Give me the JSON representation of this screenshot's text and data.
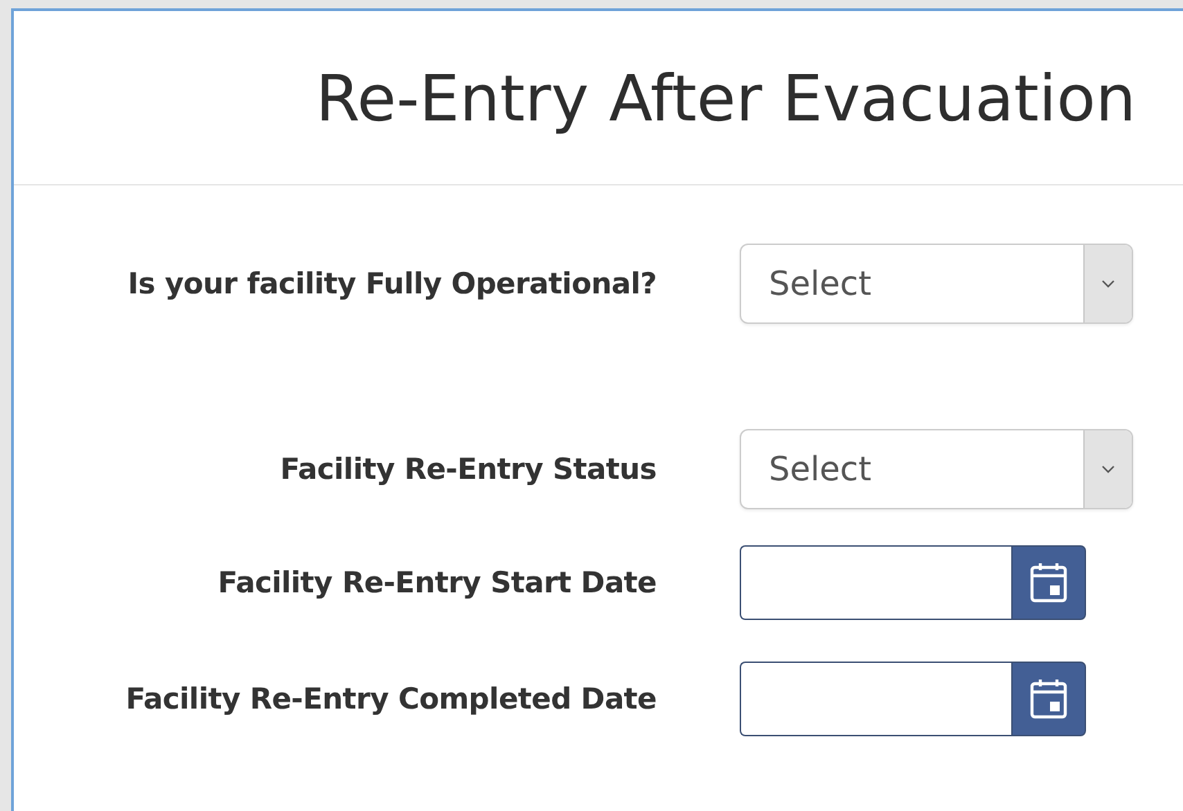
{
  "title": "Re-Entry After Evacuation",
  "fields": [
    {
      "label": "Is your facility Fully Operational?",
      "kind": "select",
      "value": "Select"
    },
    {
      "label": "Facility Re-Entry Status",
      "kind": "select",
      "value": "Select"
    },
    {
      "label": "Facility Re-Entry Start Date",
      "kind": "date"
    },
    {
      "label": "Facility Re-Entry Completed Date",
      "kind": "date"
    }
  ]
}
